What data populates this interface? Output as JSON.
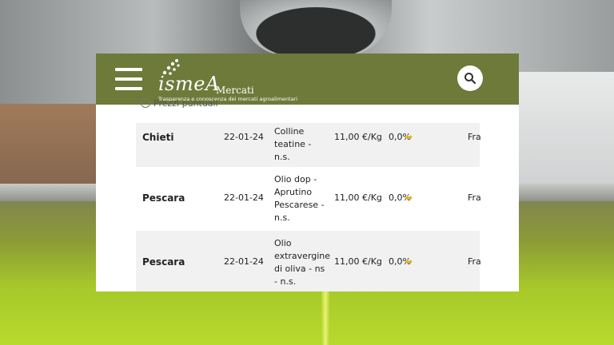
{
  "header": {
    "brand": "ismeA",
    "brand_sub": "Mercati",
    "tagline": "Trasparenza e conoscenza dei mercati agroalimentari"
  },
  "filter": {
    "partial_label": "Prezzi puntuali"
  },
  "rows": [
    {
      "city": "Chieti",
      "date": "22-01-24",
      "product": [
        "Colline",
        "teatine -",
        "n.s."
      ],
      "price": "11,00 €/Kg",
      "variation": "0,0%",
      "market": "Fra"
    },
    {
      "city": "Pescara",
      "date": "22-01-24",
      "product": [
        "Olio dop -",
        "Aprutino",
        "Pescarese -",
        "n.s."
      ],
      "price": "11,00 €/Kg",
      "variation": "0,0%",
      "market": "Fra"
    },
    {
      "city": "Pescara",
      "date": "22-01-24",
      "product": [
        "Olio",
        "extravergine",
        "di oliva - ns",
        "- n.s."
      ],
      "price": "11,00 €/Kg",
      "variation": "0,0%",
      "market": "Fra"
    }
  ],
  "icons": {
    "menu": "hamburger-icon",
    "search": "search-icon",
    "trend": "arrow-neutral-icon"
  },
  "colors": {
    "header_bg": "#6d7a3a",
    "row_alt_bg": "#f1f1f1",
    "trend_arrow": "#e3b400"
  }
}
